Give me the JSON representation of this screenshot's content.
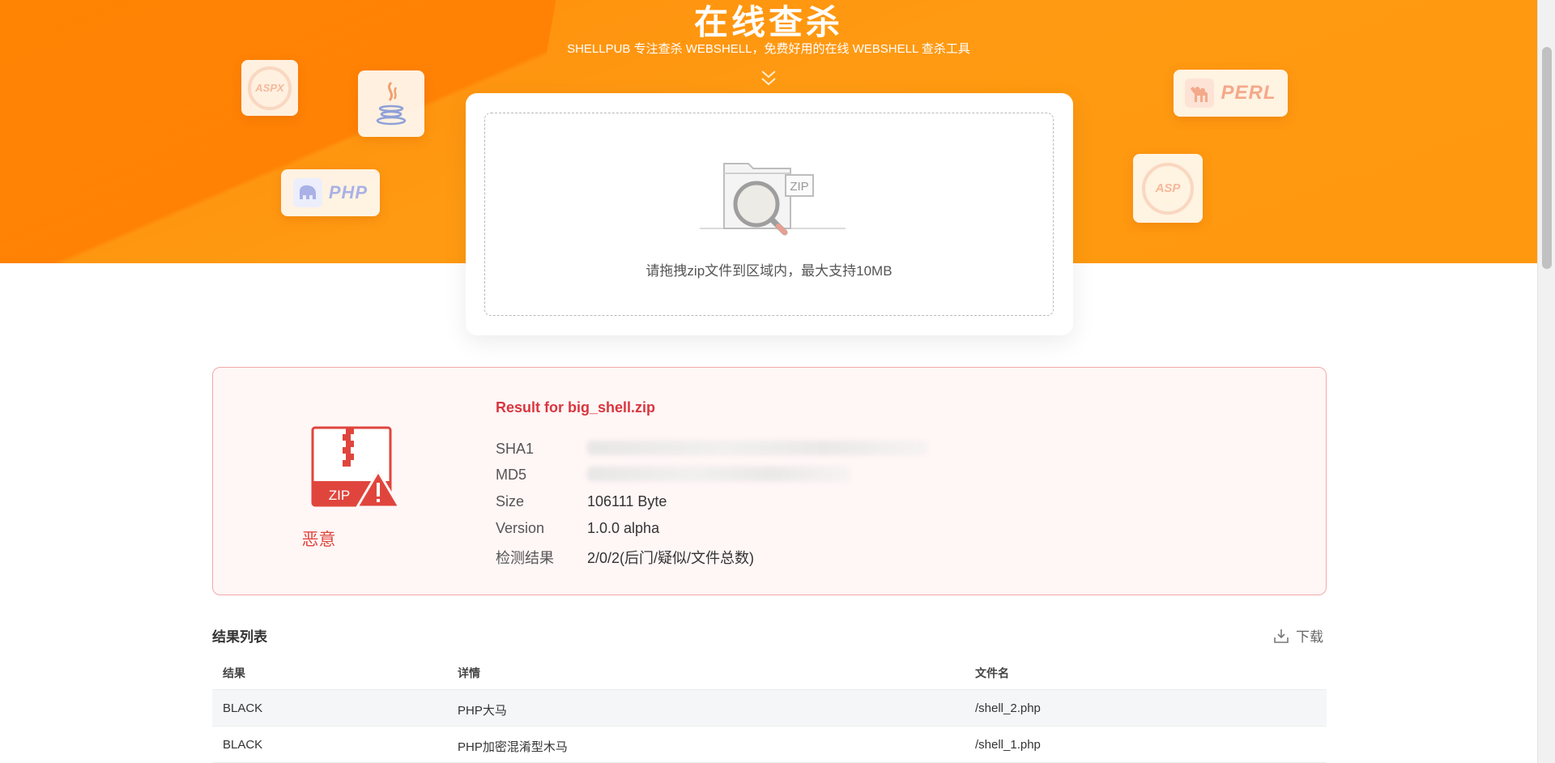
{
  "hero": {
    "title": "在线查杀",
    "subtitle": "SHELLPUB 专注查杀 WEBSHELL，免费好用的在线 WEBSHELL 查杀工具",
    "badges": {
      "aspx": "ASPX",
      "php": "PHP",
      "perl": "PERL",
      "asp": "ASP"
    }
  },
  "upload": {
    "illustration_label": "ZIP",
    "hint": "请拖拽zip文件到区域内，最大支持10MB"
  },
  "result": {
    "icon_label": "ZIP",
    "verdict": "恶意",
    "title": "Result for big_shell.zip",
    "fields": {
      "sha1_label": "SHA1",
      "md5_label": "MD5",
      "size_label": "Size",
      "size_value": "106111 Byte",
      "version_label": "Version",
      "version_value": "1.0.0 alpha",
      "detect_label": "检测结果",
      "detect_value": "2/0/2(后门/疑似/文件总数)"
    },
    "colors": {
      "danger": "#e0453d",
      "border": "#f2a9a9",
      "background": "#fff6f6"
    }
  },
  "list": {
    "title": "结果列表",
    "download_label": "下载",
    "columns": [
      "结果",
      "详情",
      "文件名"
    ],
    "rows": [
      [
        "BLACK",
        "PHP大马",
        "/shell_2.php"
      ],
      [
        "BLACK",
        "PHP加密混淆型木马",
        "/shell_1.php"
      ]
    ]
  },
  "theme": {
    "accent": "#ff9a12"
  }
}
